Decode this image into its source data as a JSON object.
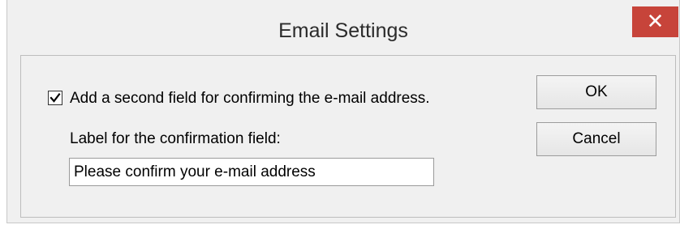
{
  "window": {
    "title": "Email Settings",
    "close_glyph": "✕"
  },
  "options": {
    "confirm_checkbox": {
      "checked": true,
      "label": "Add a second field for confirming the e-mail address."
    },
    "confirmation_label": {
      "label": "Label for the confirmation field:",
      "value": "Please confirm your e-mail address"
    }
  },
  "buttons": {
    "ok": "OK",
    "cancel": "Cancel"
  },
  "colors": {
    "close_button_bg": "#c7443a",
    "dialog_bg": "#f0f0f0"
  },
  "icons": {
    "close": "close-icon",
    "check": "checkmark-icon"
  }
}
